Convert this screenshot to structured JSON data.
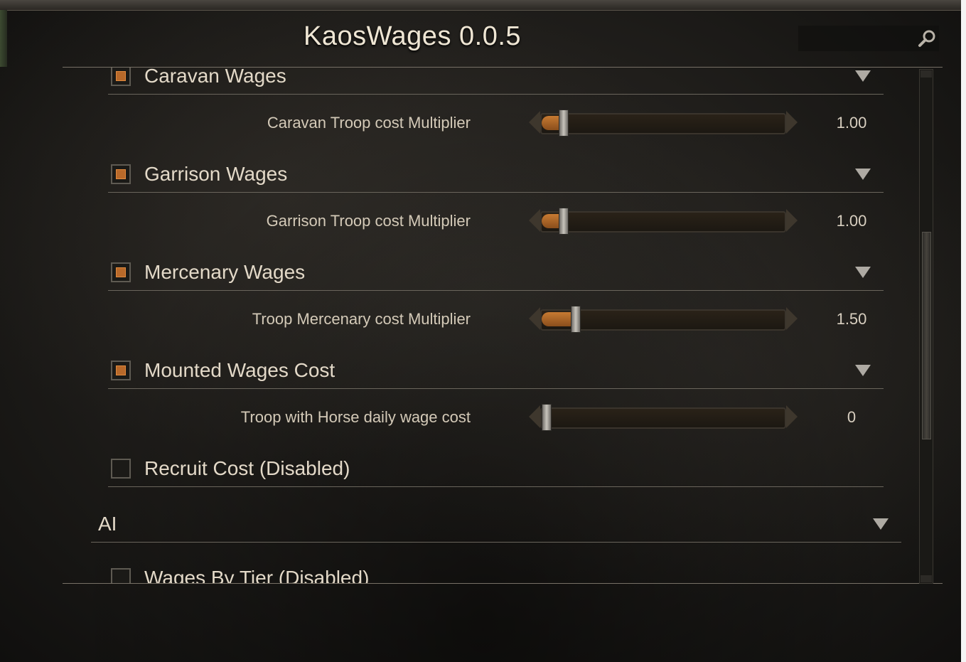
{
  "window": {
    "title": "KaosWages 0.0.5"
  },
  "search": {
    "placeholder": "",
    "icon": "search-icon"
  },
  "colors": {
    "accent": "#b8692a",
    "text": "#e3d9c8",
    "divider": "#6a655c"
  },
  "groups": [
    {
      "label": "Caravan Wages",
      "checked": true,
      "setting": {
        "label": "Caravan Troop cost Multiplier",
        "value": "1.00",
        "fraction": 0.07
      }
    },
    {
      "label": "Garrison Wages",
      "checked": true,
      "setting": {
        "label": "Garrison Troop cost Multiplier",
        "value": "1.00",
        "fraction": 0.07
      }
    },
    {
      "label": "Mercenary Wages",
      "checked": true,
      "setting": {
        "label": "Troop Mercenary cost Multiplier",
        "value": "1.50",
        "fraction": 0.12
      }
    },
    {
      "label": "Mounted Wages Cost",
      "checked": true,
      "setting": {
        "label": "Troop with Horse daily wage cost",
        "value": "0",
        "fraction": 0.0
      }
    },
    {
      "label": "Recruit Cost (Disabled)",
      "checked": false
    }
  ],
  "section": {
    "label": "AI"
  },
  "ai_group": {
    "label": "Wages By Tier (Disabled)",
    "checked": false
  },
  "scroll": {
    "position_fraction": 0.4
  }
}
